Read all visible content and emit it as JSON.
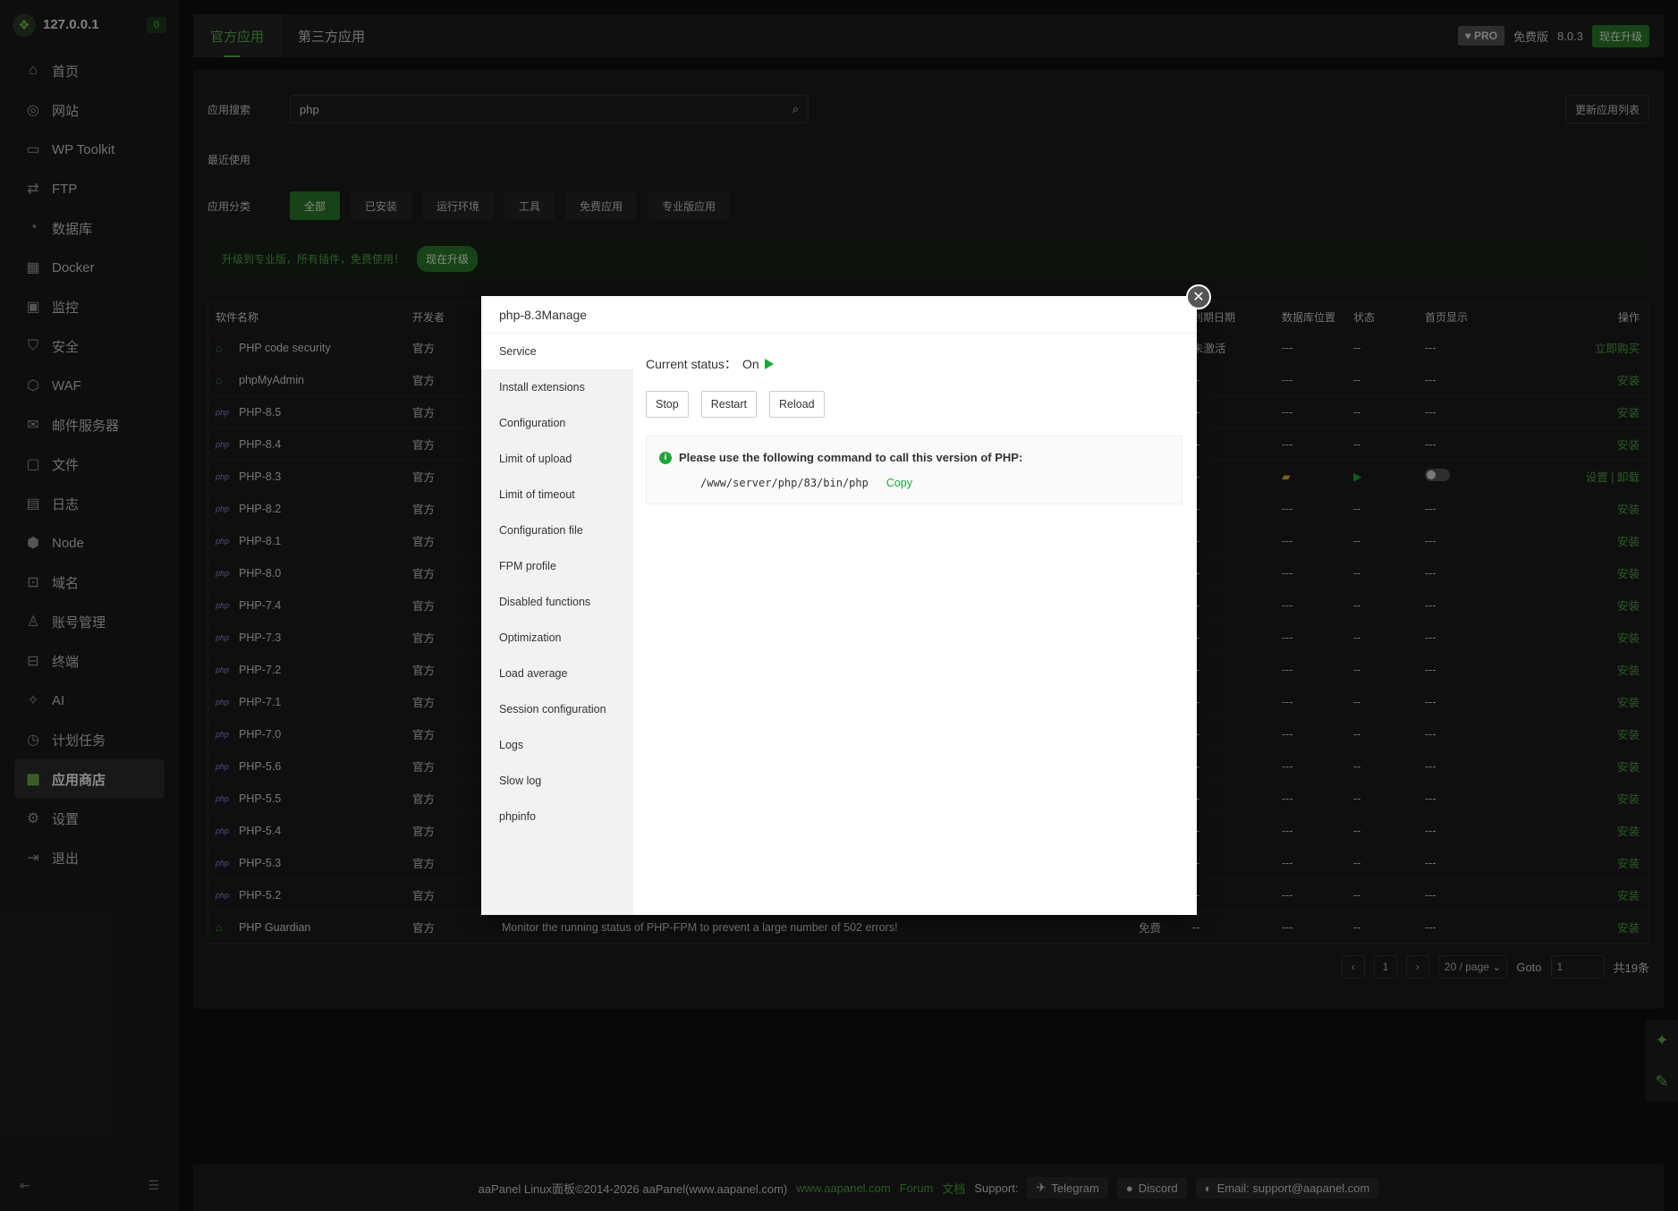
{
  "sidebar": {
    "ip": "127.0.0.1",
    "badge": "0",
    "items": [
      {
        "label": "首页",
        "icon": "home-icon",
        "glyph": "⌂"
      },
      {
        "label": "网站",
        "icon": "globe-icon",
        "glyph": "◎"
      },
      {
        "label": "WP Toolkit",
        "icon": "wordpress-icon",
        "glyph": "▭"
      },
      {
        "label": "FTP",
        "icon": "transfer-icon",
        "glyph": "⇄"
      },
      {
        "label": "数据库",
        "icon": "database-icon",
        "glyph": "◔"
      },
      {
        "label": "Docker",
        "icon": "docker-icon",
        "glyph": "▦"
      },
      {
        "label": "监控",
        "icon": "monitor-icon",
        "glyph": "▣"
      },
      {
        "label": "安全",
        "icon": "shield-icon",
        "glyph": "⛉"
      },
      {
        "label": "WAF",
        "icon": "waf-icon",
        "glyph": "⬡"
      },
      {
        "label": "邮件服务器",
        "icon": "mail-icon",
        "glyph": "✉"
      },
      {
        "label": "文件",
        "icon": "folder-icon",
        "glyph": "▢"
      },
      {
        "label": "日志",
        "icon": "log-icon",
        "glyph": "▤"
      },
      {
        "label": "Node",
        "icon": "node-icon",
        "glyph": "⬢"
      },
      {
        "label": "域名",
        "icon": "domain-icon",
        "glyph": "⊡"
      },
      {
        "label": "账号管理",
        "icon": "user-icon",
        "glyph": "♙"
      },
      {
        "label": "终端",
        "icon": "terminal-icon",
        "glyph": "⊟"
      },
      {
        "label": "AI",
        "icon": "ai-icon",
        "glyph": "✧"
      },
      {
        "label": "计划任务",
        "icon": "clock-icon",
        "glyph": "◷"
      },
      {
        "label": "应用商店",
        "icon": "store-icon",
        "glyph": "▩",
        "active": true
      },
      {
        "label": "设置",
        "icon": "gear-icon",
        "glyph": "⚙"
      },
      {
        "label": "退出",
        "icon": "logout-icon",
        "glyph": "⇥"
      }
    ]
  },
  "topbar": {
    "tab_official": "官方应用",
    "tab_third": "第三方应用",
    "pro": "PRO",
    "edition": "免费版",
    "version": "8.0.3",
    "upgrade": "现在升级"
  },
  "main": {
    "search_label": "应用搜索",
    "search_value": "php",
    "update_list": "更新应用列表",
    "recent_label": "最近使用",
    "category_label": "应用分类",
    "categories": [
      "全部",
      "已安装",
      "运行环境",
      "工具",
      "免费应用",
      "专业版应用"
    ],
    "promo_text": "升级到专业版，所有插件，免费使用！",
    "promo_button": "现在升级"
  },
  "table": {
    "headers": {
      "name": "软件名称",
      "dev": "开发者",
      "expire": "到期日期",
      "db": "数据库位置",
      "status": "状态",
      "home": "首页显示",
      "op": "操作"
    },
    "rows": [
      {
        "name": "PHP code security",
        "dev": "官方",
        "exp": "未激活",
        "db": "---",
        "st": "--",
        "home": "---",
        "op": "立即购买"
      },
      {
        "name": "phpMyAdmin",
        "dev": "官方",
        "exp": "--",
        "db": "---",
        "st": "--",
        "home": "---",
        "op": "安装"
      },
      {
        "name": "PHP-8.5",
        "dev": "官方",
        "exp": "--",
        "db": "---",
        "st": "--",
        "home": "---",
        "op": "安装"
      },
      {
        "name": "PHP-8.4",
        "dev": "官方",
        "exp": "--",
        "db": "---",
        "st": "--",
        "home": "---",
        "op": "安装"
      },
      {
        "name": "PHP-8.3",
        "dev": "官方",
        "exp": "--",
        "db": "",
        "st": "",
        "home": "",
        "op": "设置 | 卸载"
      },
      {
        "name": "PHP-8.2",
        "dev": "官方",
        "exp": "--",
        "db": "---",
        "st": "--",
        "home": "---",
        "op": "安装"
      },
      {
        "name": "PHP-8.1",
        "dev": "官方",
        "exp": "--",
        "db": "---",
        "st": "--",
        "home": "---",
        "op": "安装"
      },
      {
        "name": "PHP-8.0",
        "dev": "官方",
        "exp": "--",
        "db": "---",
        "st": "--",
        "home": "---",
        "op": "安装"
      },
      {
        "name": "PHP-7.4",
        "dev": "官方",
        "exp": "--",
        "db": "---",
        "st": "--",
        "home": "---",
        "op": "安装"
      },
      {
        "name": "PHP-7.3",
        "dev": "官方",
        "exp": "--",
        "db": "---",
        "st": "--",
        "home": "---",
        "op": "安装"
      },
      {
        "name": "PHP-7.2",
        "dev": "官方",
        "exp": "--",
        "db": "---",
        "st": "--",
        "home": "---",
        "op": "安装"
      },
      {
        "name": "PHP-7.1",
        "dev": "官方",
        "exp": "--",
        "db": "---",
        "st": "--",
        "home": "---",
        "op": "安装"
      },
      {
        "name": "PHP-7.0",
        "dev": "官方",
        "exp": "--",
        "db": "---",
        "st": "--",
        "home": "---",
        "op": "安装"
      },
      {
        "name": "PHP-5.6",
        "dev": "官方",
        "exp": "--",
        "db": "---",
        "st": "--",
        "home": "---",
        "op": "安装"
      },
      {
        "name": "PHP-5.5",
        "dev": "官方",
        "exp": "--",
        "db": "---",
        "st": "--",
        "home": "---",
        "op": "安装"
      },
      {
        "name": "PHP-5.4",
        "dev": "官方",
        "exp": "--",
        "db": "---",
        "st": "--",
        "home": "---",
        "op": "安装"
      },
      {
        "name": "PHP-5.3",
        "dev": "官方",
        "exp": "--",
        "db": "---",
        "st": "--",
        "home": "---",
        "op": "安装"
      },
      {
        "name": "PHP-5.2",
        "dev": "官方",
        "exp": "--",
        "db": "---",
        "st": "--",
        "home": "---",
        "op": "安装"
      },
      {
        "name": "PHP Guardian",
        "dev": "官方",
        "desc": "Monitor the running status of PHP-FPM to prevent a large number of 502 errors!",
        "price": "免费",
        "exp": "--",
        "db": "---",
        "st": "--",
        "home": "---",
        "op": "安装"
      }
    ]
  },
  "pager": {
    "page": "1",
    "per_page": "20 / page",
    "goto_label": "Goto",
    "goto_value": "1",
    "total": "共19条"
  },
  "footer": {
    "copyright": "aaPanel Linux面板©2014-2026 aaPanel(www.aapanel.com)",
    "site": "www.aapanel.com",
    "forum": "Forum",
    "docs": "文档",
    "support": "Support:",
    "telegram": "Telegram",
    "discord": "Discord",
    "email": "Email: support@aapanel.com"
  },
  "modal": {
    "title": "php-8.3Manage",
    "menu": [
      "Service",
      "Install extensions",
      "Configuration",
      "Limit of upload",
      "Limit of timeout",
      "Configuration file",
      "FPM profile",
      "Disabled functions",
      "Optimization",
      "Load average",
      "Session configuration",
      "Logs",
      "Slow log",
      "phpinfo"
    ],
    "status_label": "Current status：",
    "status_value": "On",
    "buttons": {
      "stop": "Stop",
      "restart": "Restart",
      "reload": "Reload"
    },
    "info_text": "Please use the following command to call this version of PHP:",
    "command": "/www/server/php/83/bin/php",
    "copy": "Copy"
  }
}
